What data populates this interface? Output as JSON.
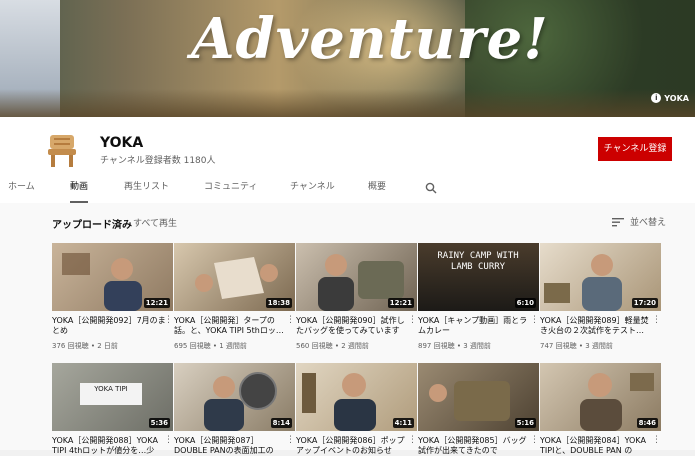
{
  "banner": {
    "title": "Adventure!",
    "badge": "YOKA"
  },
  "channel": {
    "name": "YOKA",
    "subscribers": "チャンネル登録者数 1180人",
    "subscribe_label": "チャンネル登録"
  },
  "tabs": [
    {
      "label": "ホーム"
    },
    {
      "label": "動画"
    },
    {
      "label": "再生リスト"
    },
    {
      "label": "コミュニティ"
    },
    {
      "label": "チャンネル"
    },
    {
      "label": "概要"
    }
  ],
  "section": {
    "title": "アップロード済み",
    "play_all": "すべて再生",
    "sort_label": "並べ替え"
  },
  "videos": [
    {
      "title": "YOKA［公開開発092］7月のまとめ",
      "views": "376 回視聴",
      "age": "2 日前",
      "duration": "12:21",
      "thumb_color": "#b89f85"
    },
    {
      "title": "YOKA［公開開発］タープの話。と、YOKA TIPI 5thロッ…",
      "views": "695 回視聴",
      "age": "1 週間前",
      "duration": "18:38",
      "thumb_color": "#a58f70"
    },
    {
      "title": "YOKA［公開開発090］試作したバッグを使ってみています",
      "views": "560 回視聴",
      "age": "2 週間前",
      "duration": "12:21",
      "thumb_color": "#9a8c78"
    },
    {
      "title": "YOKA［キャンプ動画］雨とラムカレー",
      "views": "897 回視聴",
      "age": "3 週間前",
      "duration": "6:10",
      "thumb_color": "#2c2a26"
    },
    {
      "title": "YOKA［公開開発089］軽量焚き火台の２次試作をテスト…",
      "views": "747 回視聴",
      "age": "3 週間前",
      "duration": "17:20",
      "thumb_color": "#c9b89c"
    },
    {
      "title": "YOKA［公開開発088］YOKA TIPI 4thロットが値分を…少",
      "views": "",
      "age": "",
      "duration": "5:36",
      "thumb_color": "#8d8f88"
    },
    {
      "title": "YOKA［公開開発087］DOUBLE PANの表面加工の",
      "views": "",
      "age": "",
      "duration": "8:14",
      "thumb_color": "#a89b88"
    },
    {
      "title": "YOKA［公開開発086］ポップアップイベントのお知らせ",
      "views": "",
      "age": "",
      "duration": "4:11",
      "thumb_color": "#c4b59a"
    },
    {
      "title": "YOKA［公開開発085］バッグ試作が出来てきたので",
      "views": "",
      "age": "",
      "duration": "5:16",
      "thumb_color": "#7c6a52"
    },
    {
      "title": "YOKA［公開開発084］YOKA TIPIと、DOUBLE PAN の",
      "views": "",
      "age": "",
      "duration": "8:46",
      "thumb_color": "#a49684"
    }
  ],
  "thumb_text": {
    "rainy": "RAINY CAMP WITH LAMB CURRY",
    "tag": "YOKA TIPI"
  }
}
